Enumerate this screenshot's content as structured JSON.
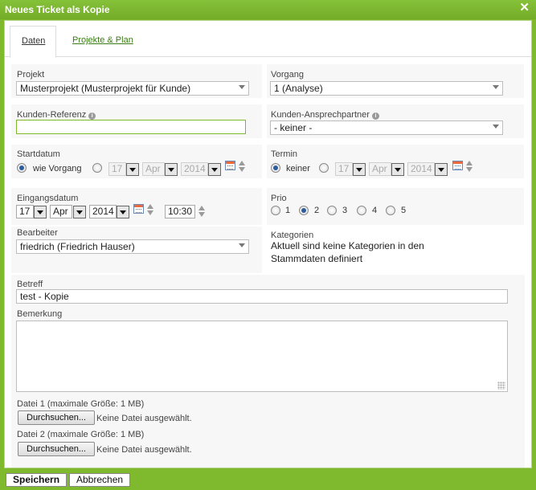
{
  "window": {
    "title": "Neues Ticket als Kopie",
    "close_symbol": "✕"
  },
  "tabs": [
    {
      "label": "Daten"
    },
    {
      "label": "Projekte & Plan"
    }
  ],
  "projekt": {
    "label": "Projekt",
    "value": "Musterprojekt (Musterprojekt für Kunde)"
  },
  "vorgang": {
    "label": "Vorgang",
    "value": "1 (Analyse)"
  },
  "kunden_referenz": {
    "label": "Kunden-Referenz",
    "value": ""
  },
  "kunden_ansprechpartner": {
    "label": "Kunden-Ansprechpartner",
    "value": "- keiner -"
  },
  "startdatum": {
    "label": "Startdatum",
    "option_label": "wie Vorgang",
    "day": "17",
    "month": "Apr",
    "year": "2014"
  },
  "termin": {
    "label": "Termin",
    "option_label": "keiner",
    "day": "17",
    "month": "Apr",
    "year": "2014"
  },
  "eingangsdatum": {
    "label": "Eingangsdatum",
    "day": "17",
    "month": "Apr",
    "year": "2014",
    "time": "10:30"
  },
  "prio": {
    "label": "Prio",
    "options": [
      "1",
      "2",
      "3",
      "4",
      "5"
    ],
    "selected": "2"
  },
  "bearbeiter": {
    "label": "Bearbeiter",
    "value": "friedrich (Friedrich Hauser)"
  },
  "kategorien": {
    "label": "Kategorien",
    "text_line1": "Aktuell sind keine Kategorien in den",
    "text_line2": "Stammdaten definiert"
  },
  "betreff": {
    "label": "Betreff",
    "value": "test - Kopie"
  },
  "bemerkung": {
    "label": "Bemerkung",
    "value": ""
  },
  "datei1": {
    "label": "Datei 1 (maximale Größe: 1 MB)",
    "button": "Durchsuchen...",
    "status": "Keine Datei ausgewählt."
  },
  "datei2": {
    "label": "Datei 2 (maximale Größe: 1 MB)",
    "button": "Durchsuchen...",
    "status": "Keine Datei ausgewählt."
  },
  "footer": {
    "save": "Speichern",
    "cancel": "Abbrechen"
  },
  "colors": {
    "accent": "#7fb92e",
    "link": "#3a7d16",
    "radio_selected": "#2a5d9a"
  },
  "icons": {
    "close": "close-icon",
    "info": "info-icon",
    "calendar": "calendar-icon",
    "spinner": "spinner-icon"
  }
}
